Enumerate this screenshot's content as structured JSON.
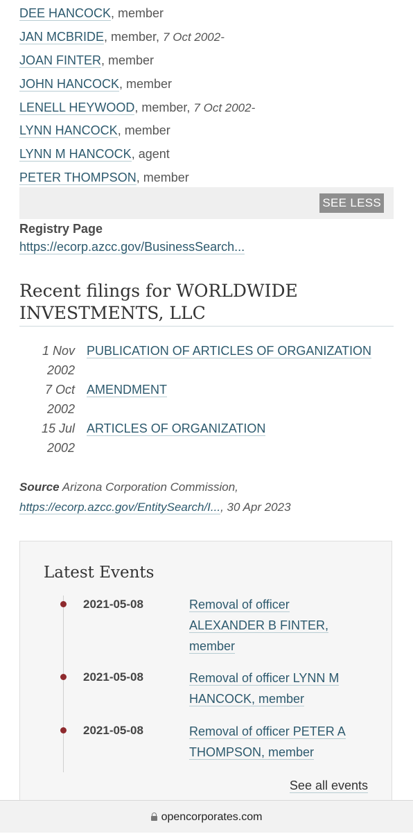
{
  "officers": [
    {
      "name": "DEE HANCOCK",
      "role": ", member",
      "date": ""
    },
    {
      "name": "JAN MCBRIDE",
      "role": ", member, ",
      "date": "7 Oct 2002-"
    },
    {
      "name": "JOAN FINTER",
      "role": ", member",
      "date": ""
    },
    {
      "name": "JOHN HANCOCK",
      "role": ", member",
      "date": ""
    },
    {
      "name": "LENELL HEYWOOD",
      "role": ", member, ",
      "date": "7 Oct 2002-"
    },
    {
      "name": "LYNN HANCOCK",
      "role": ", member",
      "date": ""
    },
    {
      "name": "LYNN M HANCOCK",
      "role": ", agent",
      "date": ""
    },
    {
      "name": "PETER THOMPSON",
      "role": ", member",
      "date": ""
    }
  ],
  "see_less_label": "SEE LESS",
  "registry": {
    "label": "Registry Page",
    "url": "https://ecorp.azcc.gov/BusinessSearch..."
  },
  "filings": {
    "heading": "Recent filings for WORLDWIDE INVESTMENTS, LLC",
    "items": [
      {
        "date_line1": "1 Nov",
        "date_line2": "2002",
        "title": "PUBLICATION OF ARTICLES OF ORGANIZATION"
      },
      {
        "date_line1": "7 Oct",
        "date_line2": "2002",
        "title": "AMENDMENT"
      },
      {
        "date_line1": "15 Jul",
        "date_line2": "2002",
        "title": "ARTICLES OF ORGANIZATION"
      }
    ]
  },
  "source": {
    "label": "Source",
    "name": "Arizona Corporation Commission,",
    "url": "https://ecorp.azcc.gov/EntitySearch/I...",
    "date": ", 30 Apr 2023"
  },
  "latest_events": {
    "heading": "Latest Events",
    "items": [
      {
        "date": "2021-05-08",
        "text": "Removal of officer ALEXANDER B FINTER, member"
      },
      {
        "date": "2021-05-08",
        "text": "Removal of officer LYNN M HANCOCK, member"
      },
      {
        "date": "2021-05-08",
        "text": "Removal of officer PETER A THOMPSON, member"
      }
    ],
    "see_all": "See all events"
  },
  "footer": {
    "domain": "opencorporates.com"
  },
  "colors": {
    "link": "#2d5a6e",
    "timeline_dot": "#8e2a2e",
    "see_less_bg": "#8e8e8e"
  },
  "icons": {
    "footer": "lock-icon"
  }
}
